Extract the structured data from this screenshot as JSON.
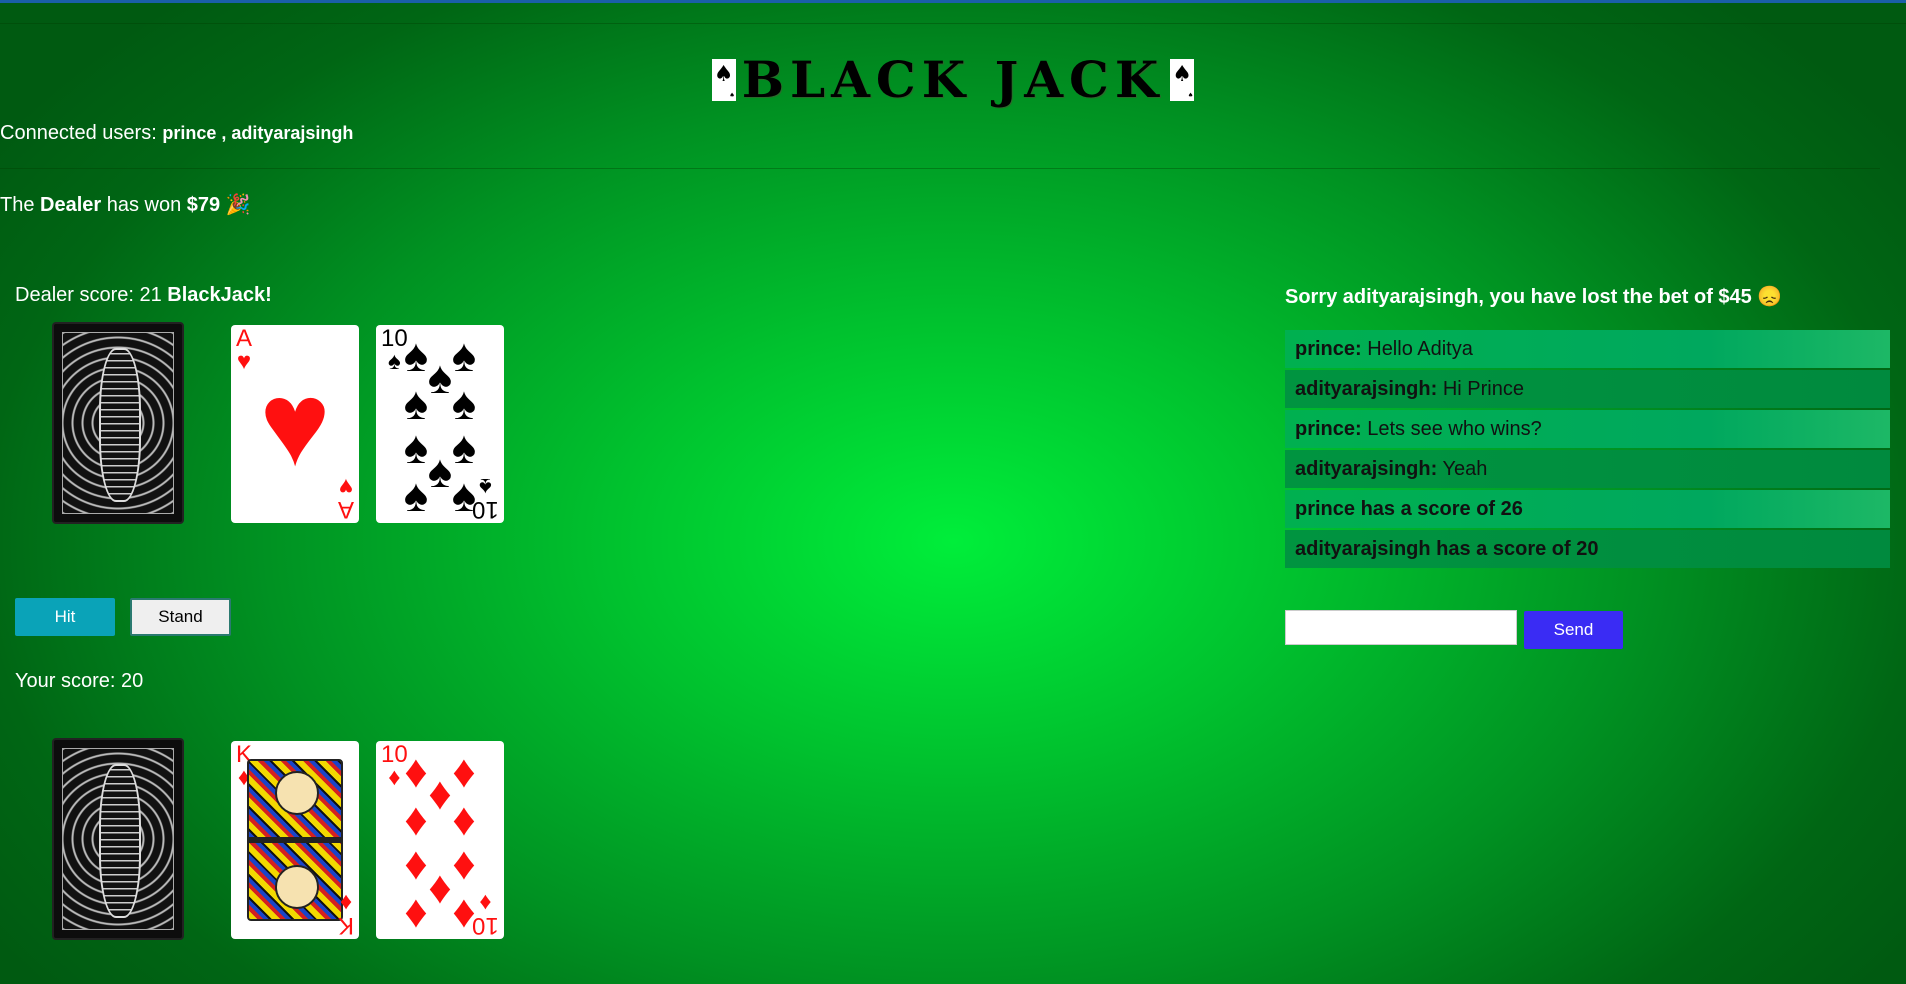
{
  "title": "BLACK JACK",
  "title_card_suit": "♠",
  "connected": {
    "label": "Connected users: ",
    "users": [
      "prince",
      "adityarajsingh"
    ],
    "separator": " , "
  },
  "result": {
    "prefix": "The ",
    "winner": "Dealer",
    "middle": " has won ",
    "amount": "$79",
    "emoji": "🎉"
  },
  "dealer": {
    "score_label": "Dealer score: 21 ",
    "score_extra": "BlackJack!",
    "cards": [
      {
        "rank": "",
        "suit": "",
        "face_down": true
      },
      {
        "rank": "A",
        "suit": "♥",
        "color": "#ff1010"
      },
      {
        "rank": "10",
        "suit": "♠",
        "color": "#000000"
      }
    ]
  },
  "player": {
    "score_label": "Your score: 20",
    "cards": [
      {
        "rank": "",
        "suit": "",
        "face_down": true
      },
      {
        "rank": "K",
        "suit": "♦",
        "color": "#ff1010"
      },
      {
        "rank": "10",
        "suit": "♦",
        "color": "#ff1010"
      }
    ]
  },
  "controls": {
    "hit_label": "Hit",
    "stand_label": "Stand"
  },
  "lost_message": "Sorry adityarajsingh, you have lost the bet of $45 😞",
  "chat": {
    "messages": [
      {
        "user": "prince:",
        "text": " Hello Aditya"
      },
      {
        "user": "adityarajsingh:",
        "text": " Hi Prince"
      },
      {
        "user": "prince:",
        "text": " Lets see who wins?"
      },
      {
        "user": "adityarajsingh:",
        "text": " Yeah"
      },
      {
        "user": "prince has a score of 26",
        "text": ""
      },
      {
        "user": "adityarajsingh has a score of 20",
        "text": ""
      }
    ],
    "input_value": "",
    "send_label": "Send"
  },
  "colors": {
    "hit_button": "#0aa3b8",
    "send_button": "#3a2cf4",
    "red_suit": "#ff1010"
  }
}
